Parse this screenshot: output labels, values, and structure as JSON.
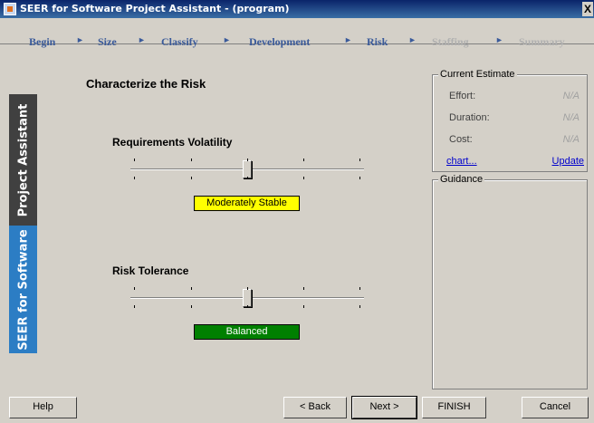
{
  "window": {
    "title": "SEER for Software Project Assistant - (program)",
    "close_glyph": "X"
  },
  "steps": [
    {
      "label": "Begin"
    },
    {
      "label": "Size"
    },
    {
      "label": "Classify"
    },
    {
      "label": "Development"
    },
    {
      "label": "Risk"
    },
    {
      "label": "Staffing",
      "disabled": true
    },
    {
      "label": "Summary",
      "disabled": true
    }
  ],
  "step_arrow": "►",
  "sidebar": {
    "tab_project_assistant": "Project Assistant",
    "tab_seer": "SEER for Software"
  },
  "main": {
    "heading": "Characterize the Risk",
    "requirements_volatility": {
      "label": "Requirements Volatility",
      "value_label": "Moderately Stable",
      "position": 0.5,
      "color": "#ffff00"
    },
    "risk_tolerance": {
      "label": "Risk Tolerance",
      "value_label": "Balanced",
      "position": 0.5,
      "color": "#008000"
    }
  },
  "estimate": {
    "legend": "Current Estimate",
    "effort_label": "Effort:",
    "effort_value": "N/A",
    "duration_label": "Duration:",
    "duration_value": "N/A",
    "cost_label": "Cost:",
    "cost_value": "N/A",
    "chart_link": "chart...",
    "update_link": "Update"
  },
  "guidance": {
    "legend": "Guidance"
  },
  "buttons": {
    "help": "Help",
    "back": "< Back",
    "next": "Next >",
    "finish": "FINISH",
    "cancel": "Cancel"
  }
}
